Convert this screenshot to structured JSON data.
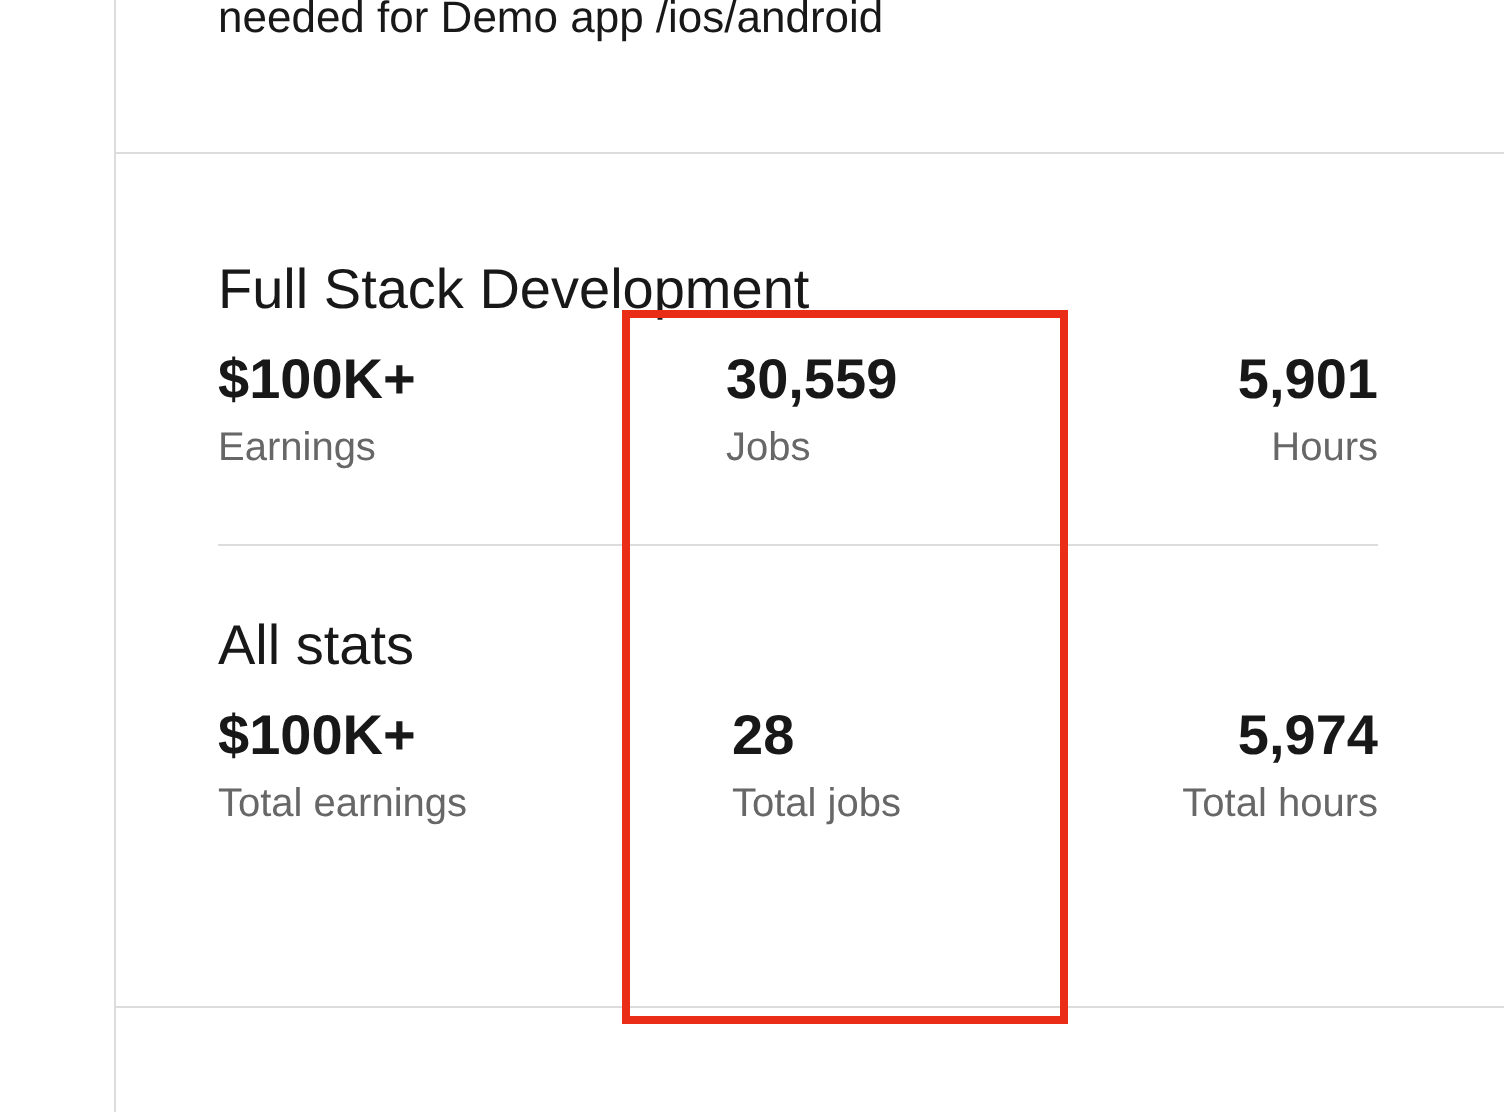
{
  "previous_section": {
    "text": "needed for Demo app /ios/android"
  },
  "stat_groups": [
    {
      "title": "Full Stack Development",
      "stats": [
        {
          "value": "$100K+",
          "label": "Earnings"
        },
        {
          "value": "30,559",
          "label": "Jobs"
        },
        {
          "value": "5,901",
          "label": "Hours"
        }
      ]
    },
    {
      "title": "All stats",
      "stats": [
        {
          "value": "$100K+",
          "label": "Total earnings"
        },
        {
          "value": "28",
          "label": "Total jobs"
        },
        {
          "value": "5,974",
          "label": "Total hours"
        }
      ]
    }
  ]
}
